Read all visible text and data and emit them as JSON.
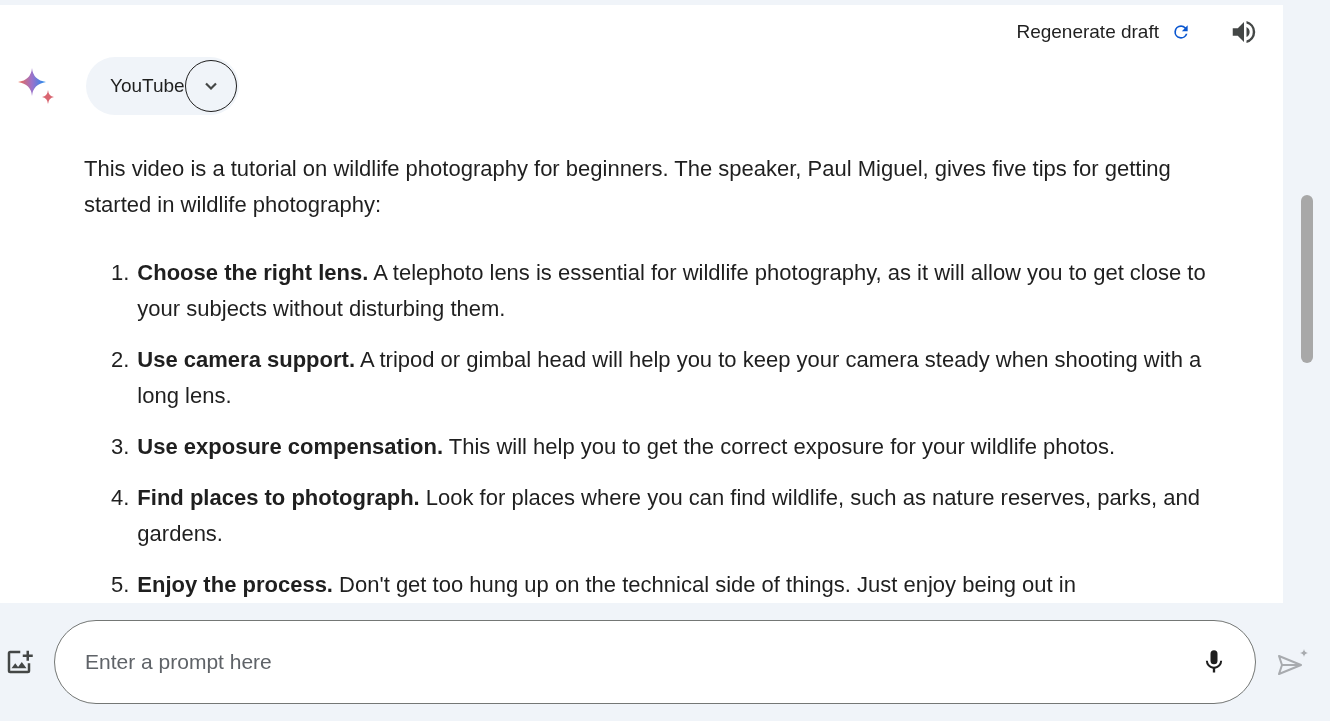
{
  "header": {
    "regenerate_label": "Regenerate draft"
  },
  "source_chip": {
    "label": "YouTube",
    "expanded": false
  },
  "response": {
    "intro": "This video is a tutorial on wildlife photography for beginners. The speaker, Paul Miguel, gives five tips for getting started in wildlife photography:",
    "tips": [
      {
        "number": "1.",
        "text": "**Choose the right lens.** A telephoto lens is essential for wildlife photography, as it will allow you to get close to your subjects without disturbing them."
      },
      {
        "number": "2.",
        "text": "**Use camera support.** A tripod or gimbal head will help you to keep your camera steady when shooting with a long lens."
      },
      {
        "number": "3.",
        "text": "**Use exposure compensation.** This will help you to get the correct exposure for your wildlife photos."
      },
      {
        "number": "4.",
        "text": "**Find places to photograph.** Look for places where you can find wildlife, such as nature reserves, parks, and gardens."
      },
      {
        "number": "5.",
        "text": "**Enjoy the process.** Don't get too hung up on the technical side of things. Just enjoy being out in"
      }
    ]
  },
  "prompt": {
    "placeholder": "Enter a prompt here"
  }
}
